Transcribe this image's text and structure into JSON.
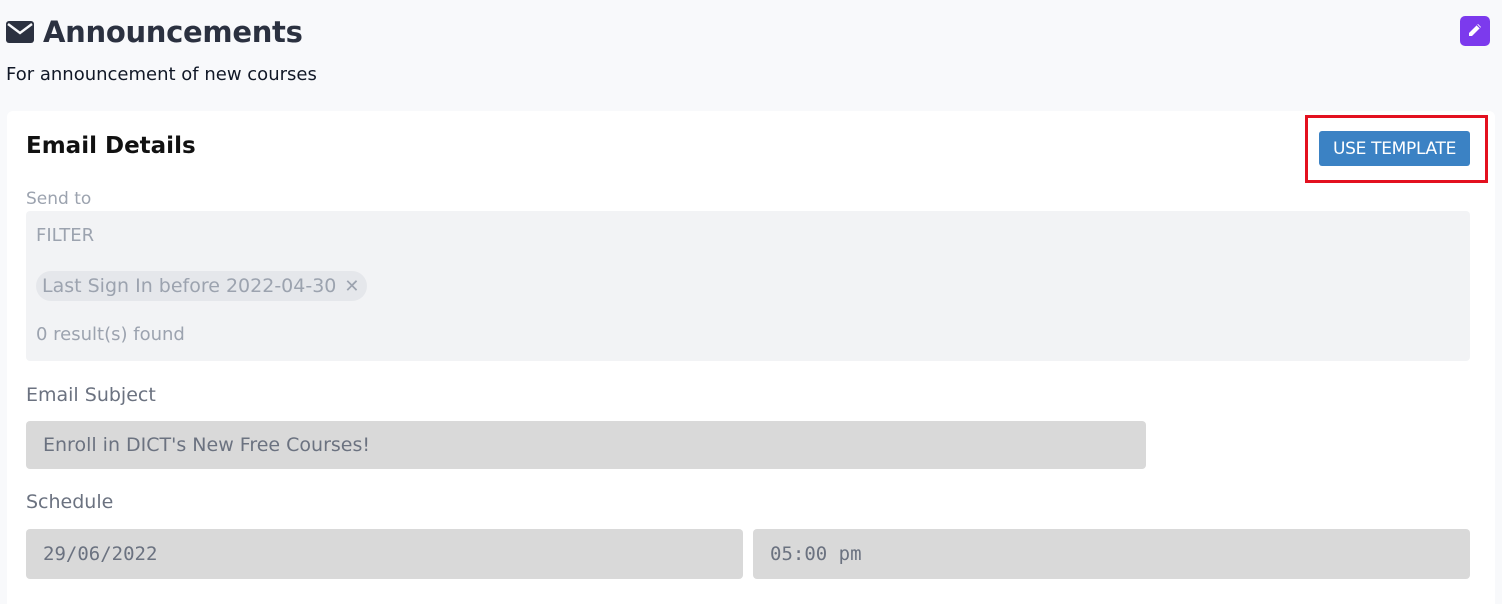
{
  "header": {
    "icon": "mail-icon",
    "title": "Announcements",
    "subtitle": "For announcement of new courses",
    "edit_icon": "pencil-icon"
  },
  "card": {
    "title": "Email Details",
    "use_template_label": "USE TEMPLATE",
    "send_to": {
      "label": "Send to",
      "filter_heading": "FILTER",
      "chips": [
        "Last Sign In before 2022-04-30"
      ],
      "chip_remove_glyph": "✕",
      "results": "0 result(s) found"
    },
    "subject": {
      "label": "Email Subject",
      "value": "Enroll in DICT's New Free Courses!"
    },
    "schedule": {
      "label": "Schedule",
      "date": "29/06/2022",
      "time": "05:00 pm"
    }
  },
  "colors": {
    "accent_purple": "#7c3aed",
    "button_blue": "#3b82c4",
    "highlight_red": "#e3101f"
  }
}
